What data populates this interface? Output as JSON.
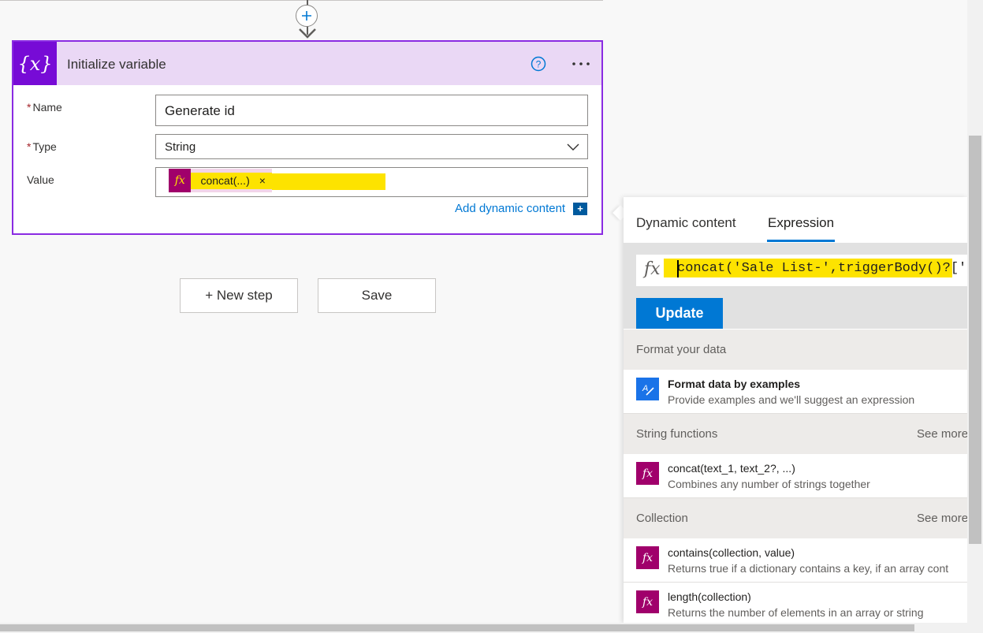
{
  "card": {
    "title": "Initialize variable",
    "icon": "{x}",
    "accent_color": "#770bd6",
    "fields": {
      "name_label": "Name",
      "name_value": "Generate id",
      "type_label": "Type",
      "type_value": "String",
      "value_label": "Value",
      "token_label": "concat(...)",
      "token_close": "×"
    },
    "add_dynamic_content": "Add dynamic content",
    "add_dynamic_icon": "+"
  },
  "actions": {
    "new_step": "+ New step",
    "save": "Save"
  },
  "panel": {
    "tabs": [
      "Dynamic content",
      "Expression"
    ],
    "active_tab": "Expression",
    "expression_text": "concat('Sale List-',triggerBody()?['Jol",
    "update_label": "Update",
    "sections": [
      {
        "title": "Format your data",
        "see_more": "",
        "items": [
          {
            "title": "Format data by examples",
            "desc": "Provide examples and we'll suggest an expression",
            "icon": "format-data-icon",
            "icon_color": "#1a73e8"
          }
        ]
      },
      {
        "title": "String functions",
        "see_more": "See more",
        "items": [
          {
            "title": "concat(text_1, text_2?, ...)",
            "desc": "Combines any number of strings together",
            "icon": "fx-icon",
            "icon_color": "#a0006b"
          }
        ]
      },
      {
        "title": "Collection",
        "see_more": "See more",
        "items": [
          {
            "title": "contains(collection, value)",
            "desc": "Returns true if a dictionary contains a key, if an array cont",
            "icon": "fx-icon",
            "icon_color": "#a0006b"
          },
          {
            "title": "length(collection)",
            "desc": "Returns the number of elements in an array or string",
            "icon": "fx-icon",
            "icon_color": "#a0006b"
          }
        ]
      }
    ]
  }
}
